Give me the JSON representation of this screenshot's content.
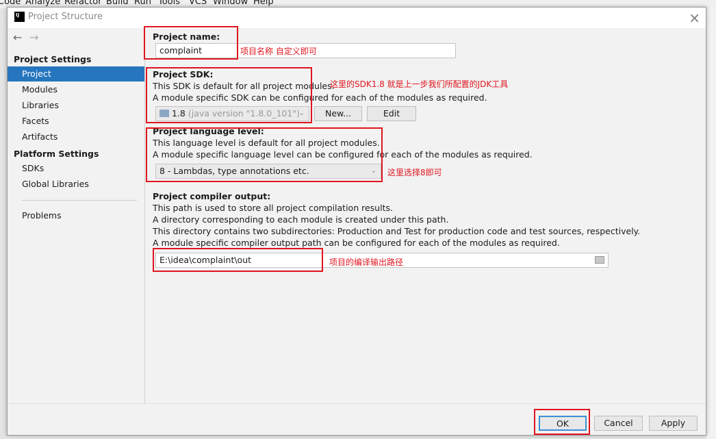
{
  "ide": {
    "menu": [
      "Code",
      "Analyze",
      "Refactor",
      "Build",
      "Run",
      "Tools",
      "VCS",
      "Window",
      "Help"
    ]
  },
  "dialog": {
    "title": "Project Structure",
    "close": "×"
  },
  "sidebar": {
    "back": "←",
    "forward": "→",
    "project_settings": "Project Settings",
    "items": [
      "Project",
      "Modules",
      "Libraries",
      "Facets",
      "Artifacts"
    ],
    "platform_settings": "Platform Settings",
    "platform_items": [
      "SDKs",
      "Global Libraries"
    ],
    "problems": "Problems"
  },
  "project_name": {
    "label": "Project name:",
    "value": "complaint",
    "note": "项目名称 自定义即可"
  },
  "sdk": {
    "label": "Project SDK:",
    "desc1": "This SDK is default for all project modules.",
    "desc2": "A module specific SDK can be configured for each of the modules as required.",
    "selected": "1.8",
    "selected_detail": "(java version \"1.8.0_101\")",
    "new": "New...",
    "edit": "Edit",
    "note": "这里的SDK1.8 就是上一步我们所配置的JDK工具"
  },
  "language": {
    "label": "Project language level:",
    "desc1": "This language level is default for all project modules.",
    "desc2": "A module specific language level can be configured for each of the modules as required.",
    "selected": "8 - Lambdas, type annotations etc.",
    "note": "这里选择8即可"
  },
  "compiler": {
    "label": "Project compiler output:",
    "desc1": "This path is used to store all project compilation results.",
    "desc2": "A directory corresponding to each module is created under this path.",
    "desc3": "This directory contains two subdirectories: Production and Test for production code and test sources, respectively.",
    "desc4": "A module specific compiler output path can be configured for each of the modules as required.",
    "value": "E:\\idea\\complaint\\out",
    "note": "项目的编译输出路径"
  },
  "footer": {
    "ok": "OK",
    "cancel": "Cancel",
    "apply": "Apply"
  },
  "colors": {
    "selection": "#2675bf",
    "annotation": "#e0141e"
  }
}
